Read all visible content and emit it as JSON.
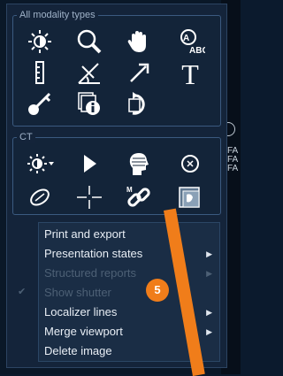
{
  "groups": {
    "all_modality": {
      "title": "All modality types"
    },
    "ct": {
      "title": "CT"
    }
  },
  "tools_all": [
    {
      "icon": "brightness-icon"
    },
    {
      "icon": "magnifier-icon"
    },
    {
      "icon": "pan-hand-icon"
    },
    {
      "icon": "zoom-text-icon"
    },
    {
      "icon": "ruler-icon"
    },
    {
      "icon": "angle-icon"
    },
    {
      "icon": "arrow-icon"
    },
    {
      "icon": "text-annotation-icon"
    },
    {
      "icon": "key-icon"
    },
    {
      "icon": "info-icon"
    },
    {
      "icon": "reset-icon"
    }
  ],
  "tools_ct": [
    {
      "icon": "window-preset-icon"
    },
    {
      "icon": "cine-play-icon"
    },
    {
      "icon": "head-3d-icon"
    },
    {
      "icon": "target-icon"
    },
    {
      "icon": "ellipse-roi-icon"
    },
    {
      "icon": "crosshair-icon"
    },
    {
      "icon": "link-icon"
    },
    {
      "icon": "stack-icon"
    }
  ],
  "text_annotation_glyph": "T",
  "menu": {
    "items": [
      {
        "label": "Print and export",
        "submenu": false,
        "enabled": true
      },
      {
        "label": "Presentation states",
        "submenu": true,
        "enabled": true
      },
      {
        "label": "Structured reports",
        "submenu": true,
        "enabled": false
      },
      {
        "label": "Show shutter",
        "submenu": false,
        "enabled": false,
        "checked": true
      },
      {
        "label": "Localizer lines",
        "submenu": true,
        "enabled": true
      },
      {
        "label": "Merge viewport",
        "submenu": true,
        "enabled": true
      },
      {
        "label": "Delete image",
        "submenu": false,
        "enabled": true
      }
    ]
  },
  "overlay_text": [
    "FA",
    "FA",
    "FA"
  ],
  "annotation": {
    "badge": "5",
    "color": "#f07d1a"
  },
  "colors": {
    "panel": "#14243a",
    "group_border": "#3b5a80",
    "menu": "#1a2d45",
    "accent": "#f07d1a"
  }
}
